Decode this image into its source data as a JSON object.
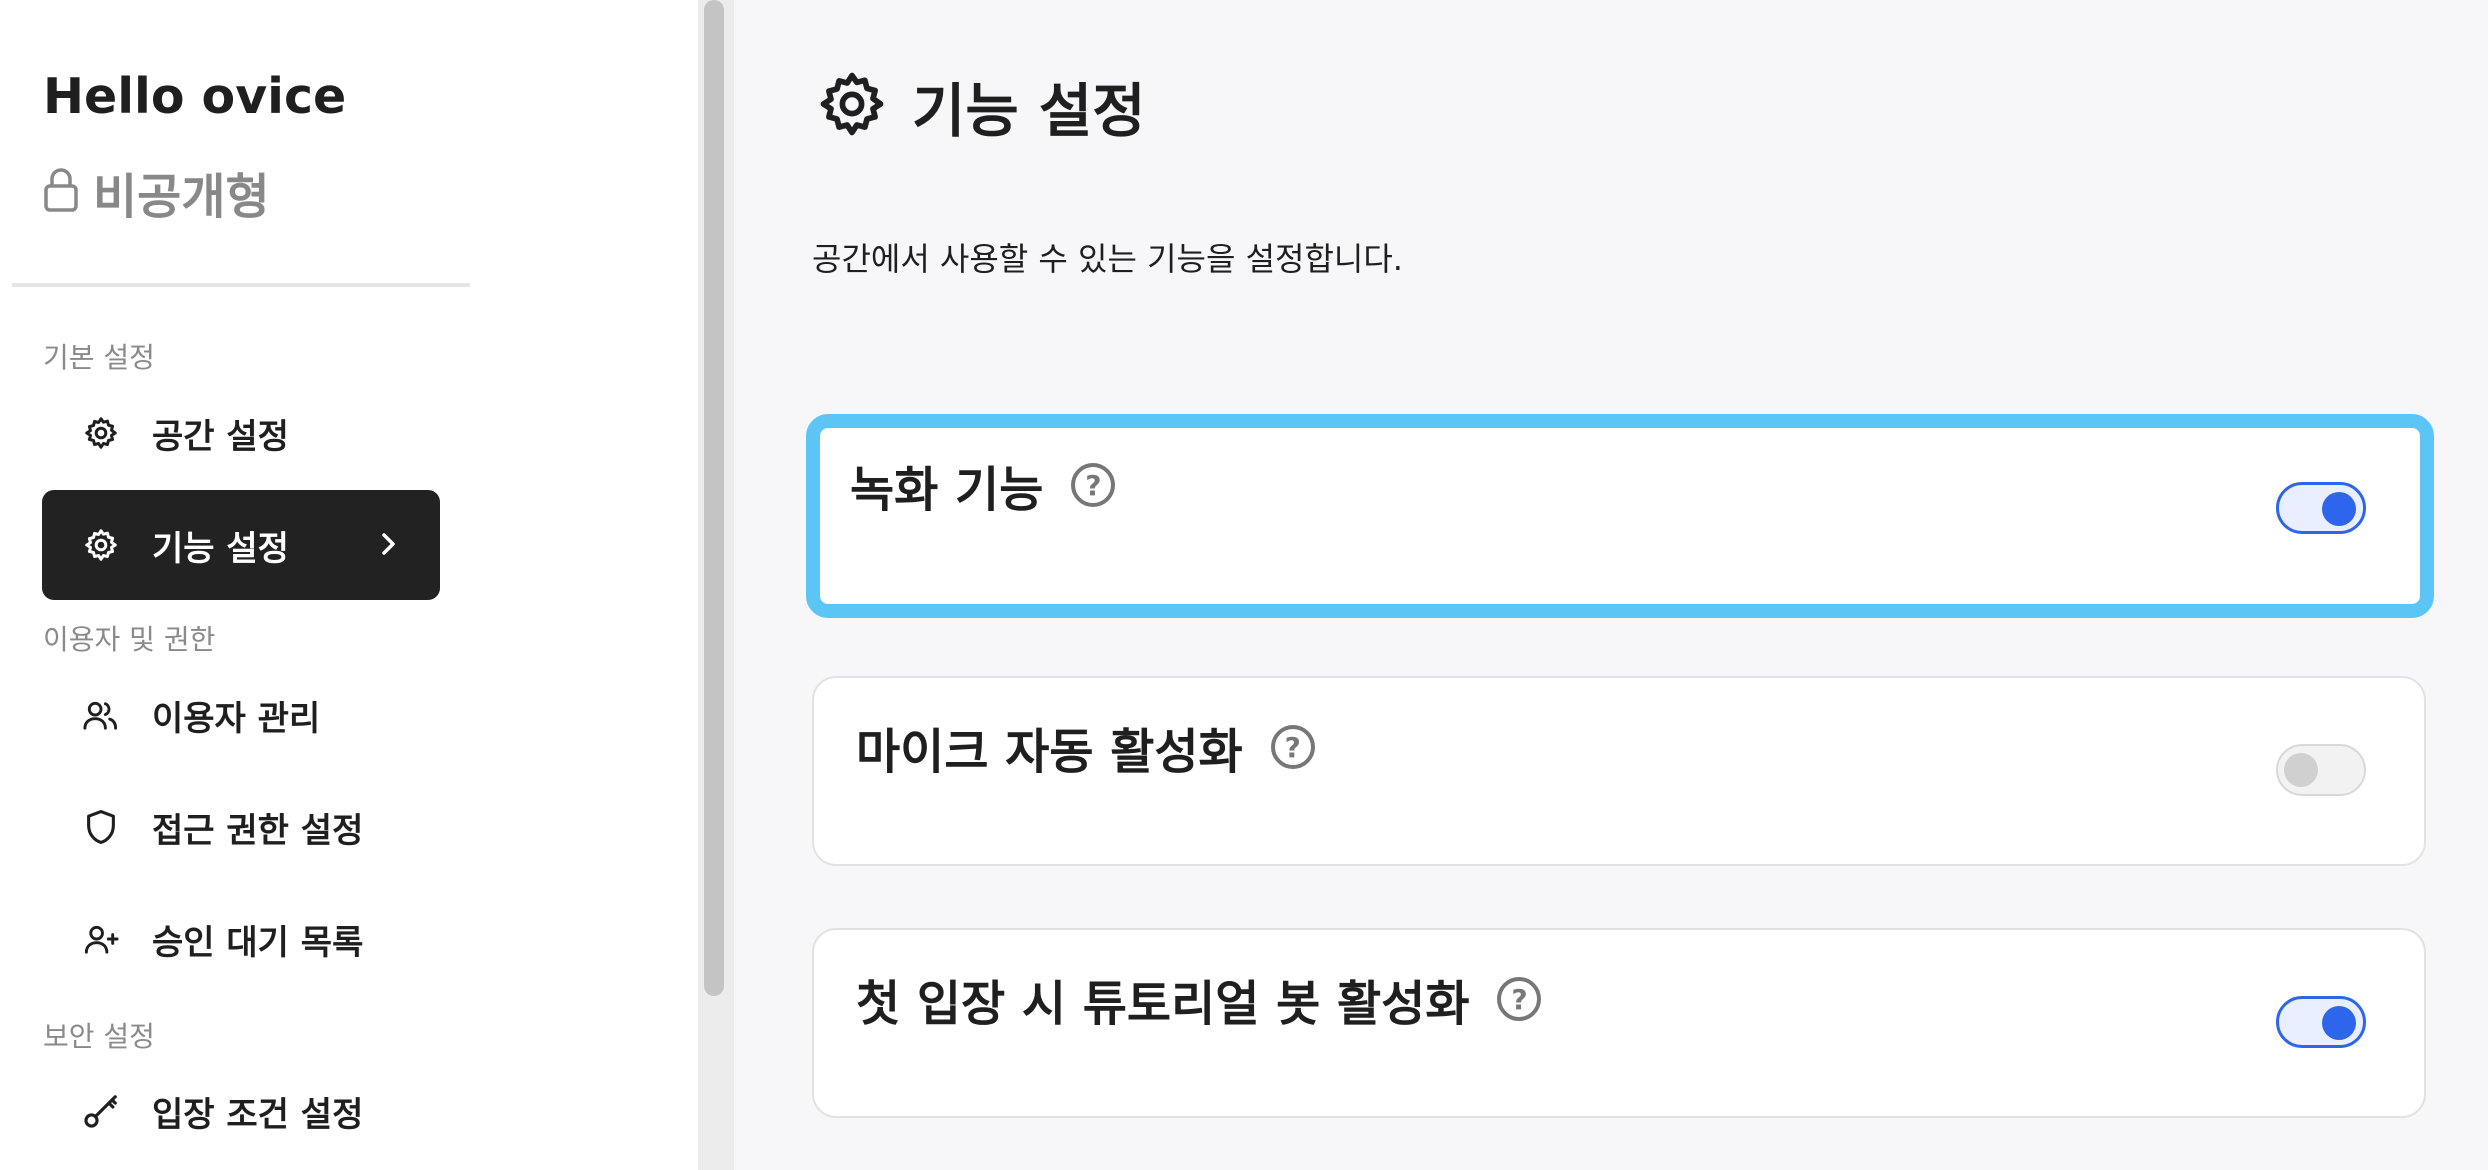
{
  "sidebar": {
    "space_name": "Hello ovice",
    "privacy_label": "비공개형",
    "sections": {
      "basic": "기본 설정",
      "users": "이용자 및 권한",
      "security": "보안 설정"
    },
    "items": [
      {
        "label": "공간 설정",
        "icon": "gear-icon"
      },
      {
        "label": "기능 설정",
        "icon": "gear-icon",
        "active": true
      },
      {
        "label": "이용자 관리",
        "icon": "users-icon"
      },
      {
        "label": "접근 권한 설정",
        "icon": "shield-icon"
      },
      {
        "label": "승인 대기 목록",
        "icon": "user-plus-icon"
      },
      {
        "label": "입장 조건 설정",
        "icon": "key-icon"
      }
    ]
  },
  "main": {
    "title": "기능 설정",
    "description": "공간에서 사용할 수 있는 기능을 설정합니다.",
    "features": [
      {
        "label": "녹화 기능",
        "enabled": true
      },
      {
        "label": "마이크 자동 활성화",
        "enabled": false
      },
      {
        "label": "첫 입장 시 튜토리얼 봇 활성화",
        "enabled": true
      }
    ]
  },
  "colors": {
    "accent": "#2d66ea",
    "focus_outline": "#5bc5f5",
    "active_nav_bg": "#222222"
  }
}
